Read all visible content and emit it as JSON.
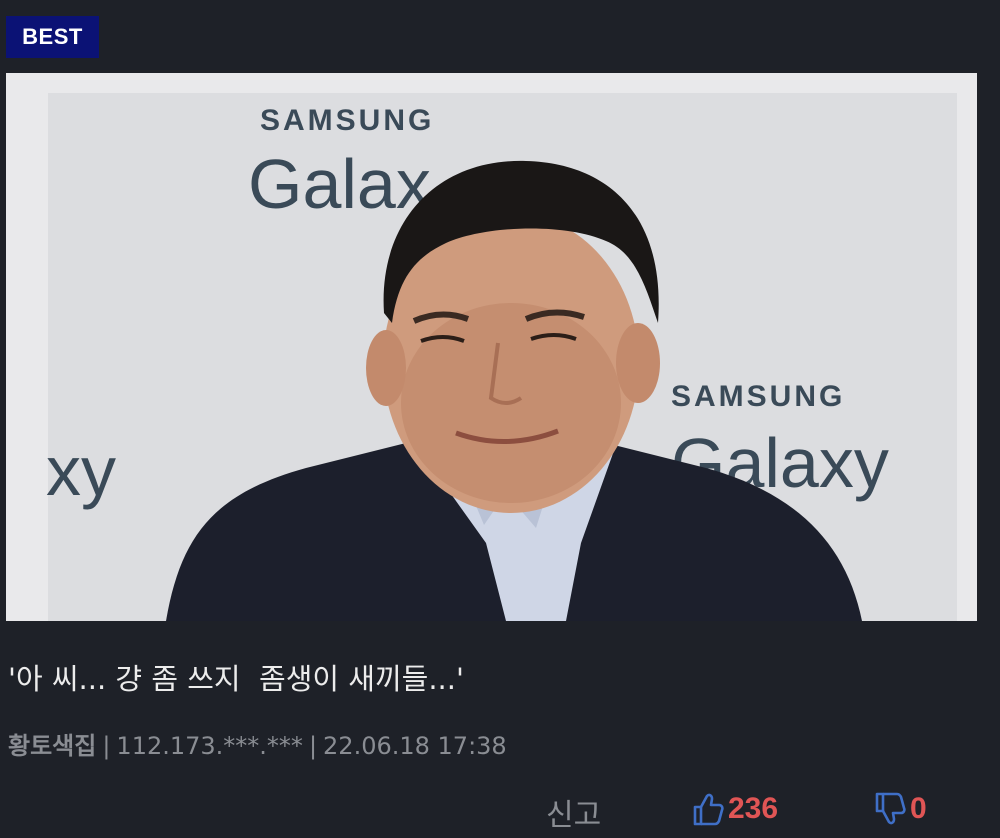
{
  "badge": "BEST",
  "photo": {
    "logo_brand_1": "SAMSUNG",
    "logo_product_1": "Galax",
    "logo_brand_2": "SAMSUNG",
    "logo_product_2": "Galaxy",
    "logo_fragment_left": "xy"
  },
  "post": {
    "title": "'아 씨... 걍 좀 쓰지  좀생이 새끼들...'",
    "author": "황토색집",
    "separator": "|",
    "ip": "112.173.***.***",
    "datetime": "22.06.18 17:38"
  },
  "actions": {
    "report_label": "신고",
    "like_count": "236",
    "dislike_count": "0",
    "like_icon": "thumbs-up-icon",
    "dislike_icon": "thumbs-down-icon"
  },
  "colors": {
    "background": "#1e2128",
    "badge": "#0b1275",
    "count": "#e05555",
    "icon": "#3f6fc7",
    "meta": "#8a8d93"
  }
}
